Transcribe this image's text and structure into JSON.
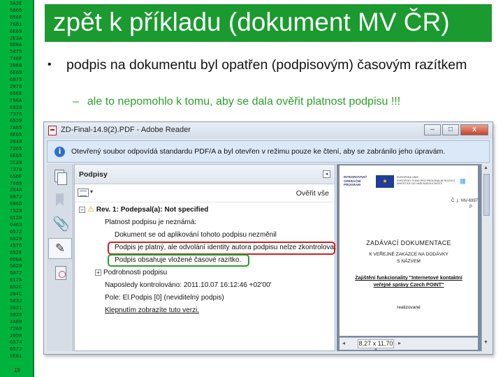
{
  "hex_strip": {
    "codes": [
      "3A2E",
      "5665",
      "656F",
      "7661",
      "6E69",
      "2E3A",
      "0D0A",
      "5475",
      "746F",
      "2068",
      "6E69",
      "6875",
      "2076",
      "656E",
      "756A",
      "6920",
      "7376",
      "6520",
      "7A65",
      "6E65",
      "2048",
      "7265",
      "6E65",
      "2C20",
      "7379",
      "656F",
      "7669",
      "204A",
      "6972",
      "696D",
      "7520",
      "6120",
      "6463",
      "6572",
      "6920",
      "4576",
      "652E",
      "0D0A",
      "5620",
      "5072",
      "617A",
      "652C",
      "204C",
      "5032",
      "3031",
      "3020",
      "4A69",
      "7269",
      "2050",
      "6574",
      "6572",
      "6E61"
    ],
    "page_number": "19"
  },
  "slide": {
    "title": "zpět k příkladu (dokument MV ČR)",
    "bullet_main": "podpis na dokumentu byl opatřen (podpisovým) časovým razítkem",
    "bullet_marker": "•",
    "sub_marker": "–",
    "bullet_sub": "ale to nepomohlo k tomu, aby se dala ověřit platnost podpisu !!!"
  },
  "window": {
    "title": "ZD-Final-14.9(2).PDF - Adobe Reader",
    "buttons": {
      "minimize": "–",
      "maximize": "□",
      "close": "x"
    },
    "info_bar_text": "Otevřený soubor odpovídá standardu PDF/A a byl otevřen v režimu pouze ke čtení, aby se zabránilo jeho úpravám.",
    "info_icon_glyph": "i",
    "signatures_panel": {
      "header": "Podpisy",
      "collapse_glyph": "◂",
      "options_caret": "▾",
      "verify_all": "Ověřit vše",
      "tree": {
        "rev_expander": "−",
        "rev_label": "Rev. 1: Podepsal(a): Not specified",
        "validity_unknown": "Platnost podpisu je neznámá:",
        "doc_not_modified": "Dokument se od aplikování tohoto podpisu nezměnil",
        "signer_identity": "Podpis je platný, ale odvolání identity autora podpisu nelze zkontrolovat",
        "timestamp": "Podpis obsahuje vložené časové razítko.",
        "details_expander": "+",
        "details": "Podrobnosti podpisu",
        "last_checked": "Naposledy kontrolováno: 2011.10.07 16:12:46 +02'00'",
        "field": "Pole: El.Podpis [0] (neviditelný podpis)",
        "click_to_show": "Klepnutím zobrazíte tuto verzi."
      }
    },
    "preview": {
      "logo_lines": [
        "INTEGROVANÝ",
        "OPERAČNÍ",
        "PROGRAM"
      ],
      "flag_glyph": "★",
      "eu_text_lines": [
        "EVROPSKÁ UNIE",
        "EVROPSKÝ FOND PRO REGIONÁLNÍ ROZVOJ",
        "INVESTICE DO VAŠÍ BUDOUCNOSTI"
      ],
      "ref_number": "Č. j.: MV-6997",
      "ref_suffix": "P",
      "doc_title": "ZADÁVACÍ DOKUMENTACE",
      "subtitle_1": "K VEŘEJNÉ ZAKÁZCE NA DODÁVKY",
      "subtitle_2": "S NÁZVEM",
      "project_1": "Zajištění funkcionality \"Internetové kontaktní",
      "project_2": "veřejné správy Czech POINT\"",
      "realized": "realizované",
      "zoom": "8,27 x 11,70 \""
    }
  }
}
